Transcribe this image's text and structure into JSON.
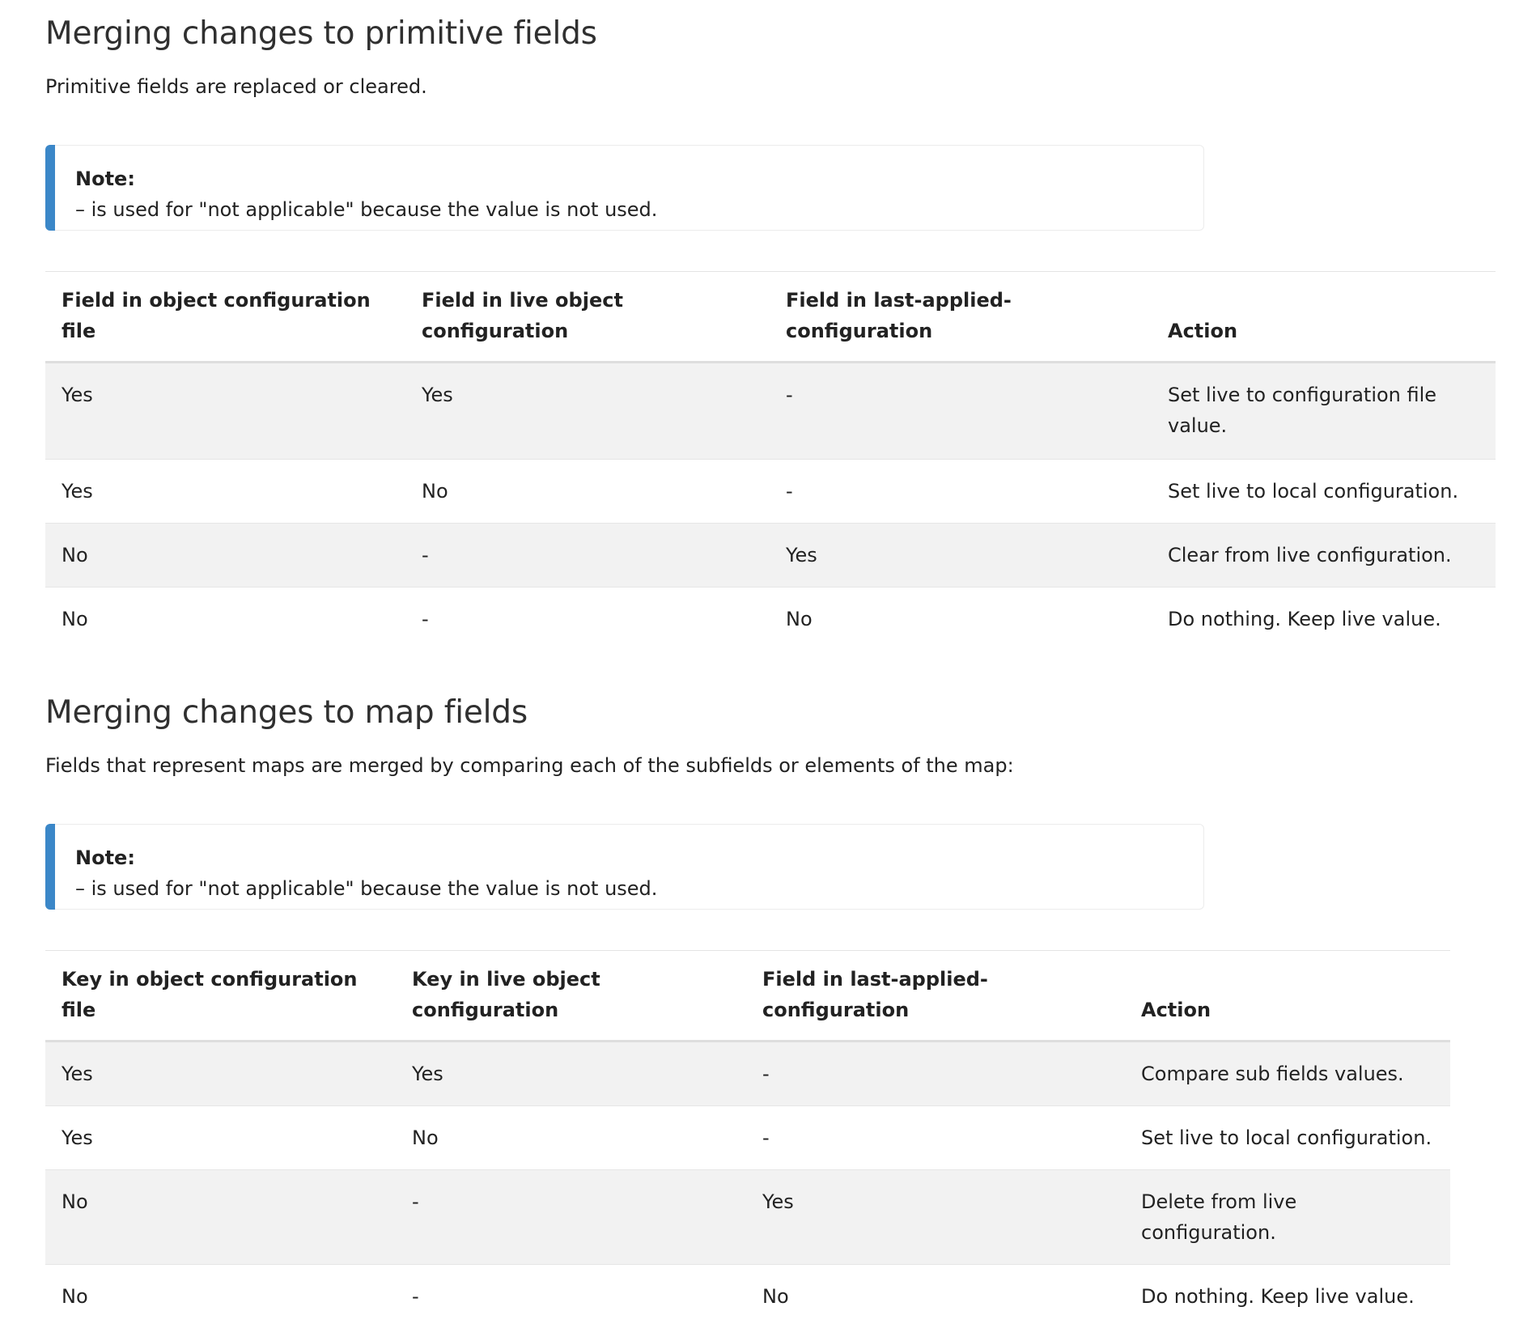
{
  "section1": {
    "title": "Merging changes to primitive fields",
    "lead": "Primitive fields are replaced or cleared.",
    "note": {
      "title": "Note:",
      "text": "– is used for \"not applicable\" because the value is not used."
    },
    "table": {
      "headers": [
        "Field in object configuration file",
        "Field in live object configuration",
        "Field in last-applied-configuration",
        "Action"
      ],
      "rows": [
        [
          "Yes",
          "Yes",
          "-",
          "Set live to configuration file value."
        ],
        [
          "Yes",
          "No",
          "-",
          "Set live to local configuration."
        ],
        [
          "No",
          "-",
          "Yes",
          "Clear from live configuration."
        ],
        [
          "No",
          "-",
          "No",
          "Do nothing. Keep live value."
        ]
      ]
    }
  },
  "section2": {
    "title": "Merging changes to map fields",
    "lead": "Fields that represent maps are merged by comparing each of the subfields or elements of the map:",
    "note": {
      "title": "Note:",
      "text": "– is used for \"not applicable\" because the value is not used."
    },
    "table": {
      "headers": [
        "Key in object configuration file",
        "Key in live object configuration",
        "Field in last-applied-configuration",
        "Action"
      ],
      "rows": [
        [
          "Yes",
          "Yes",
          "-",
          "Compare sub fields values."
        ],
        [
          "Yes",
          "No",
          "-",
          "Set live to local configuration."
        ],
        [
          "No",
          "-",
          "Yes",
          "Delete from live configuration."
        ],
        [
          "No",
          "-",
          "No",
          "Do nothing. Keep live value."
        ]
      ]
    }
  },
  "colors": {
    "note_accent": "#3b87c8",
    "row_stripe": "#f2f2f2"
  }
}
